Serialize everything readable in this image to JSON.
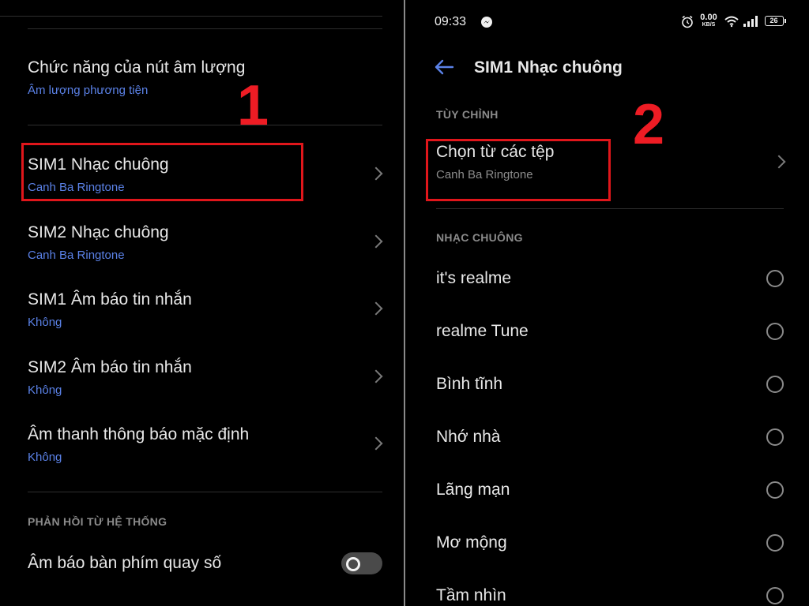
{
  "left": {
    "volume_button": {
      "title": "Chức năng của nút âm lượng",
      "value": "Âm lượng phương tiện"
    },
    "items": [
      {
        "title": "SIM1 Nhạc chuông",
        "value": "Canh Ba Ringtone"
      },
      {
        "title": "SIM2 Nhạc chuông",
        "value": "Canh Ba Ringtone"
      },
      {
        "title": "SIM1 Âm báo tin nhắn",
        "value": "Không"
      },
      {
        "title": "SIM2 Âm báo tin nhắn",
        "value": "Không"
      },
      {
        "title": "Âm thanh thông báo mặc định",
        "value": "Không"
      }
    ],
    "section_feedback": "PHẢN HỒI TỪ HỆ THỐNG",
    "dial_pad": {
      "title": "Âm báo bàn phím quay số",
      "enabled": false
    }
  },
  "right": {
    "status_bar": {
      "time": "09:33",
      "net_speed": "0.00",
      "net_unit": "KB/S",
      "battery": "26"
    },
    "header": {
      "title": "SIM1 Nhạc chuông"
    },
    "section_custom": "TÙY CHỈNH",
    "choose_file": {
      "title": "Chọn từ các tệp",
      "value": "Canh Ba Ringtone"
    },
    "section_ringtones": "NHẠC CHUÔNG",
    "ringtones": [
      "it's realme",
      "realme Tune",
      "Bình tĩnh",
      "Nhớ nhà",
      "Lãng mạn",
      "Mơ mộng",
      "Tầm nhìn"
    ]
  },
  "annotations": {
    "step1": "1",
    "step2": "2",
    "highlight_color": "#e0161b",
    "number_color": "#ee1c24"
  },
  "colors": {
    "accent": "#5b82e8",
    "background": "#000000"
  }
}
